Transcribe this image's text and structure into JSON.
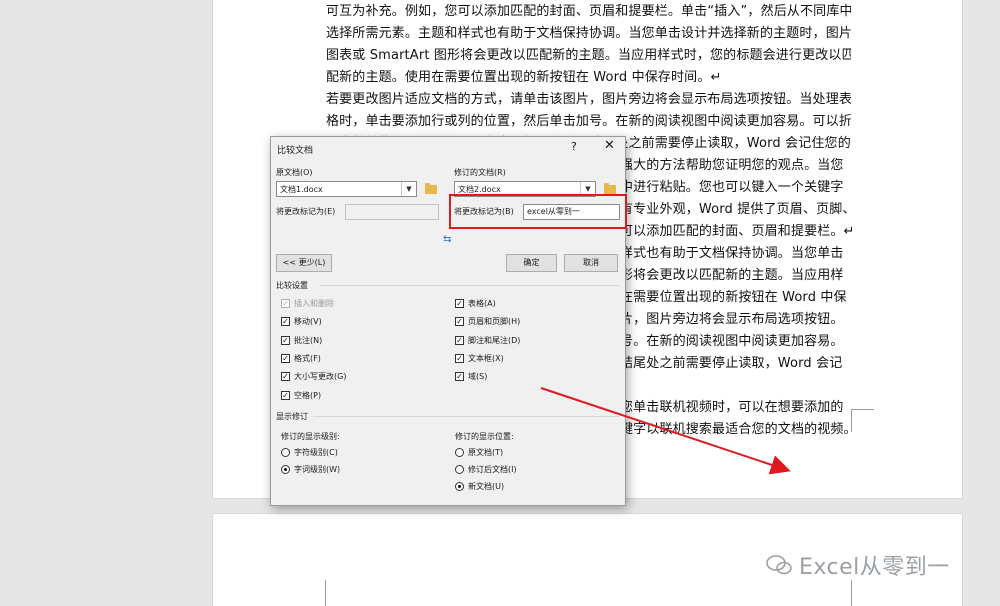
{
  "document": {
    "lines": [
      "可互为补充。例如，您可以添加匹配的封面、页眉和提要栏。单击“插入”，然后从不同库中",
      "选择所需元素。主题和样式也有助于文档保持协调。当您单击设计并选择新的主题时，图片、",
      "图表或 SmartArt 图形将会更改以匹配新的主题。当应用样式时，您的标题会进行更改以匹",
      "配新的主题。使用在需要位置出现的新按钮在 Word 中保存时间。↵",
      "若要更改图片适应文档的方式，请单击该图片，图片旁边将会显示布局选项按钮。当处理表",
      "格时，单击要添加行或列的位置，然后单击加号。在新的阅读视图中阅读更加容易。可以折",
      "叠文档某些部分并关注所需文本。如果在达到结尾处之前需要停止读取，Word 会记住您的"
    ],
    "right_lines": [
      "强大的方法帮助您证明您的观点。当您",
      "中进行粘贴。您也可以键入一个关键字",
      "有专业外观，Word 提供了页眉、页脚、",
      "可以添加匹配的封面、页眉和提要栏。↵",
      "样式也有助于文档保持协调。当您单击",
      "形将会更改以匹配新的主题。当应用样",
      "在需要位置出现的新按钮在 Word 中保",
      "片，图片旁边将会显示布局选项按钮。",
      "号。在新的阅读视图中阅读更加容易。",
      "结尾处之前需要停止读取，Word 会记",
      "",
      "您单击联机视频时，可以在想要添加的",
      "键字以联机搜索最适合您的文档的视频。"
    ]
  },
  "watermark": {
    "text": "Excel从零到一"
  },
  "dialog": {
    "title": "比较文档",
    "help": "?",
    "close": "✕",
    "original_label": "原文档(O)",
    "original_value": "文档1.docx",
    "original_mark_label": "将更改标记为(E)",
    "revised_label": "修订的文档(R)",
    "revised_value": "文档2.docx",
    "revised_mark_label": "将更改标记为(B)",
    "revised_mark_value": "excel从零到一",
    "less_button": "<< 更少(L)",
    "ok_button": "确定",
    "cancel_button": "取消",
    "compare_settings": "比较设置",
    "options_left": [
      {
        "label": "插入和删除",
        "checked": true,
        "disabled": true
      },
      {
        "label": "移动(V)",
        "checked": true,
        "disabled": false
      },
      {
        "label": "批注(N)",
        "checked": true,
        "disabled": false
      },
      {
        "label": "格式(F)",
        "checked": true,
        "disabled": false
      },
      {
        "label": "大小写更改(G)",
        "checked": true,
        "disabled": false
      },
      {
        "label": "空格(P)",
        "checked": true,
        "disabled": false
      }
    ],
    "options_right": [
      {
        "label": "表格(A)",
        "checked": true
      },
      {
        "label": "页眉和页脚(H)",
        "checked": true
      },
      {
        "label": "脚注和尾注(D)",
        "checked": true
      },
      {
        "label": "文本框(X)",
        "checked": true
      },
      {
        "label": "域(S)",
        "checked": true
      }
    ],
    "show_changes": "显示修订",
    "level_label": "修订的显示级别:",
    "level_options": [
      {
        "label": "字符级别(C)",
        "selected": false
      },
      {
        "label": "字词级别(W)",
        "selected": true
      }
    ],
    "position_label": "修订的显示位置:",
    "position_options": [
      {
        "label": "原文档(T)",
        "selected": false
      },
      {
        "label": "修订后文档(I)",
        "selected": false
      },
      {
        "label": "新文档(U)",
        "selected": true
      }
    ]
  },
  "annotation": {
    "box_color": "#e0191f",
    "arrow_color": "#e0191f"
  }
}
